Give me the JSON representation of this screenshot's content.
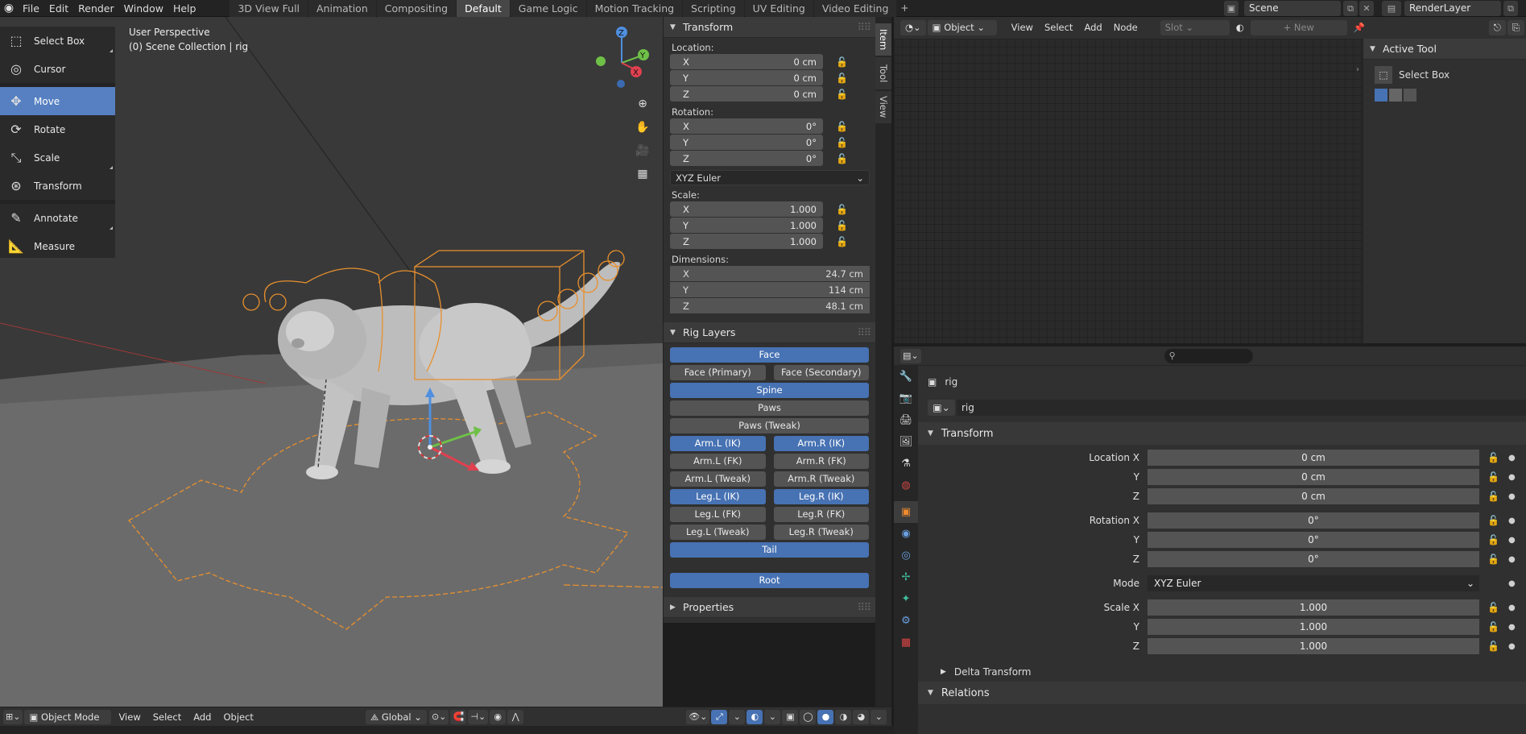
{
  "topbar": {
    "menus": [
      "File",
      "Edit",
      "Render",
      "Window",
      "Help"
    ],
    "workspaces": [
      "3D View Full",
      "Animation",
      "Compositing",
      "Default",
      "Game Logic",
      "Motion Tracking",
      "Scripting",
      "UV Editing",
      "Video Editing"
    ],
    "active_workspace": "Default",
    "scene": "Scene",
    "render_layer": "RenderLayer"
  },
  "viewport": {
    "perspective": "User Perspective",
    "collection": "(0) Scene Collection | rig"
  },
  "toolbar": {
    "tools": [
      {
        "label": "Select Box",
        "icon": "select-box-icon"
      },
      {
        "label": "Cursor",
        "icon": "cursor-icon"
      },
      {
        "label": "Move",
        "icon": "move-icon"
      },
      {
        "label": "Rotate",
        "icon": "rotate-icon"
      },
      {
        "label": "Scale",
        "icon": "scale-icon"
      },
      {
        "label": "Transform",
        "icon": "transform-icon"
      },
      {
        "label": "Annotate",
        "icon": "annotate-icon"
      },
      {
        "label": "Measure",
        "icon": "measure-icon"
      }
    ],
    "active_tool": "Move"
  },
  "npanel": {
    "tabs": [
      "Item",
      "Tool",
      "View"
    ],
    "active_tab": "Item",
    "transform": {
      "title": "Transform",
      "location_label": "Location:",
      "location": [
        {
          "axis": "X",
          "value": "0 cm"
        },
        {
          "axis": "Y",
          "value": "0 cm"
        },
        {
          "axis": "Z",
          "value": "0 cm"
        }
      ],
      "rotation_label": "Rotation:",
      "rotation": [
        {
          "axis": "X",
          "value": "0°"
        },
        {
          "axis": "Y",
          "value": "0°"
        },
        {
          "axis": "Z",
          "value": "0°"
        }
      ],
      "rotation_mode": "XYZ Euler",
      "scale_label": "Scale:",
      "scale": [
        {
          "axis": "X",
          "value": "1.000"
        },
        {
          "axis": "Y",
          "value": "1.000"
        },
        {
          "axis": "Z",
          "value": "1.000"
        }
      ],
      "dimensions_label": "Dimensions:",
      "dimensions": [
        {
          "axis": "X",
          "value": "24.7 cm"
        },
        {
          "axis": "Y",
          "value": "114 cm"
        },
        {
          "axis": "Z",
          "value": "48.1 cm"
        }
      ]
    },
    "rig_layers": {
      "title": "Rig Layers",
      "face": "Face",
      "face_primary": "Face (Primary)",
      "face_secondary": "Face (Secondary)",
      "spine": "Spine",
      "paws": "Paws",
      "paws_tweak": "Paws (Tweak)",
      "arm_l_ik": "Arm.L (IK)",
      "arm_r_ik": "Arm.R (IK)",
      "arm_l_fk": "Arm.L (FK)",
      "arm_r_fk": "Arm.R (FK)",
      "arm_l_tweak": "Arm.L (Tweak)",
      "arm_r_tweak": "Arm.R (Tweak)",
      "leg_l_ik": "Leg.L (IK)",
      "leg_r_ik": "Leg.R (IK)",
      "leg_l_fk": "Leg.L (FK)",
      "leg_r_fk": "Leg.R (FK)",
      "leg_l_tweak": "Leg.L (Tweak)",
      "leg_r_tweak": "Leg.R (Tweak)",
      "tail": "Tail",
      "root": "Root"
    },
    "properties_title": "Properties"
  },
  "viewport_header": {
    "mode": "Object Mode",
    "menus": [
      "View",
      "Select",
      "Add",
      "Object"
    ],
    "orientation": "Global"
  },
  "shader_editor": {
    "type": "Object",
    "menus": [
      "View",
      "Select",
      "Add",
      "Node"
    ],
    "slot": "Slot",
    "new_label": "New",
    "active_tool_title": "Active Tool",
    "active_tool_name": "Select Box"
  },
  "properties": {
    "object_name": "rig",
    "data_name": "rig",
    "transform_title": "Transform",
    "location": [
      {
        "label": "Location X",
        "value": "0 cm"
      },
      {
        "label": "Y",
        "value": "0 cm"
      },
      {
        "label": "Z",
        "value": "0 cm"
      }
    ],
    "rotation": [
      {
        "label": "Rotation X",
        "value": "0°"
      },
      {
        "label": "Y",
        "value": "0°"
      },
      {
        "label": "Z",
        "value": "0°"
      }
    ],
    "mode_label": "Mode",
    "mode_value": "XYZ Euler",
    "scale": [
      {
        "label": "Scale X",
        "value": "1.000"
      },
      {
        "label": "Y",
        "value": "1.000"
      },
      {
        "label": "Z",
        "value": "1.000"
      }
    ],
    "delta_transform": "Delta Transform",
    "relations": "Relations"
  },
  "colors": {
    "accent_blue": "#4772b3",
    "rig_orange": "#e8902e",
    "tool_active": "#5680c2"
  }
}
